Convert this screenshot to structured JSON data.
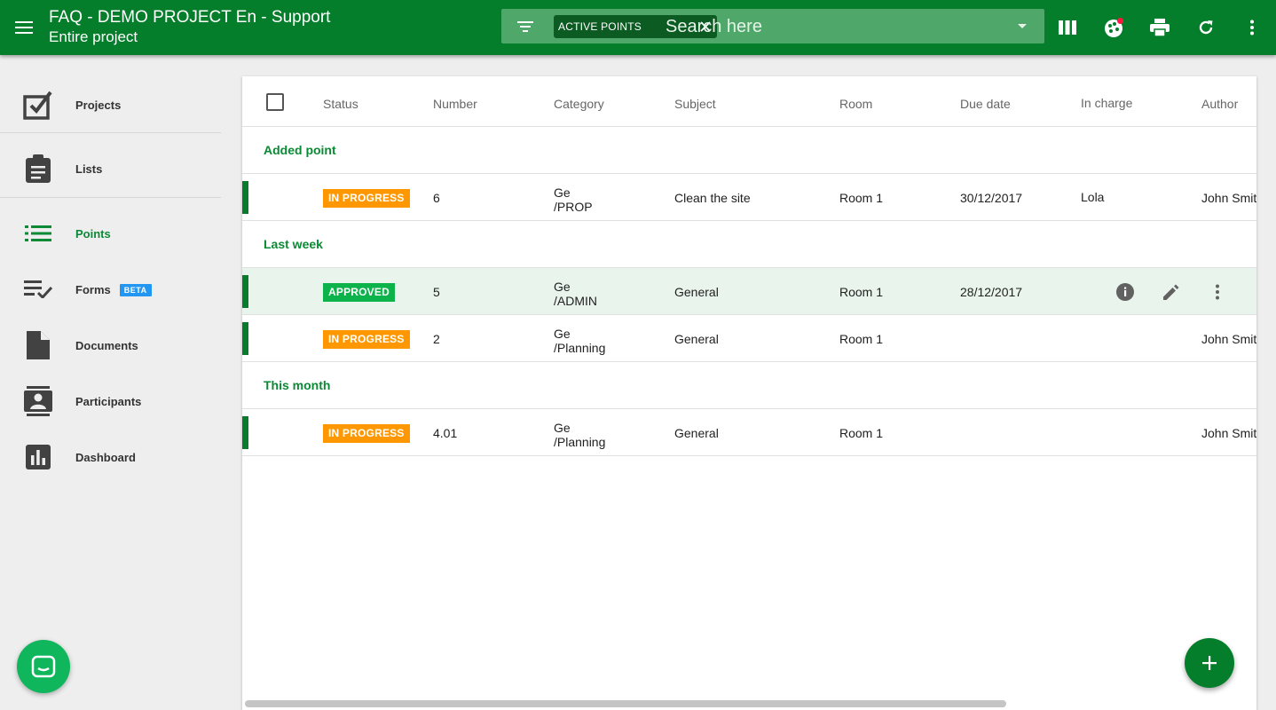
{
  "header": {
    "title": "FAQ - DEMO PROJECT En - Support",
    "subtitle": "Entire project",
    "background": "#047e2a",
    "filter_chip": "ACTIVE POINTS",
    "search_placeholder": "Search here",
    "icons": [
      "menu-icon",
      "filter-icon",
      "close-icon",
      "caret-down-icon",
      "columns-icon",
      "colors-icon",
      "print-icon",
      "refresh-icon",
      "more-vert-icon"
    ]
  },
  "sidebar": {
    "items": [
      {
        "label": "Projects",
        "icon": "projects-check-icon"
      },
      {
        "label": "Lists",
        "icon": "clipboard-icon"
      },
      {
        "label": "Points",
        "icon": "list-icon",
        "active": true
      },
      {
        "label": "Forms",
        "icon": "playlist-check-icon",
        "badge": "BETA"
      },
      {
        "label": "Documents",
        "icon": "document-icon"
      },
      {
        "label": "Participants",
        "icon": "contacts-icon"
      },
      {
        "label": "Dashboard",
        "icon": "chart-icon"
      }
    ],
    "active_color": "#0a8a34",
    "beta_color": "#2196f3"
  },
  "table": {
    "columns": [
      "Status",
      "Number",
      "Category",
      "Subject",
      "Room",
      "Due date",
      "In charge",
      "Author"
    ],
    "groups": [
      {
        "label": "Added point",
        "rows": [
          {
            "status": "IN PROGRESS",
            "number": "6",
            "category": [
              "Ge",
              "/PROP"
            ],
            "subject": "Clean the site",
            "room": "Room 1",
            "due": "30/12/2017",
            "in_charge": "Lola",
            "author": "John Smith"
          }
        ]
      },
      {
        "label": "Last week",
        "rows": [
          {
            "status": "APPROVED",
            "number": "5",
            "category": [
              "Ge",
              "/ADMIN"
            ],
            "subject": "General",
            "room": "Room 1",
            "due": "28/12/2017",
            "in_charge": "",
            "author": ""
          },
          {
            "status": "IN PROGRESS",
            "number": "2",
            "category": [
              "Ge",
              "/Planning"
            ],
            "subject": "General",
            "room": "Room 1",
            "due": "",
            "in_charge": "",
            "author": "John Smith"
          }
        ]
      },
      {
        "label": "This month",
        "rows": [
          {
            "status": "IN PROGRESS",
            "number": "4.01",
            "category": [
              "Ge",
              "/Planning"
            ],
            "subject": "General",
            "room": "Room 1",
            "due": "",
            "in_charge": "",
            "author": "John Smith"
          }
        ]
      }
    ],
    "status_colors": {
      "IN PROGRESS": "#ff9800",
      "APPROVED": "#0cb34a"
    },
    "row_marker_color": "#0a7a2d",
    "hover_row_actions": [
      "info-icon",
      "edit-icon",
      "more-vert-icon"
    ]
  }
}
